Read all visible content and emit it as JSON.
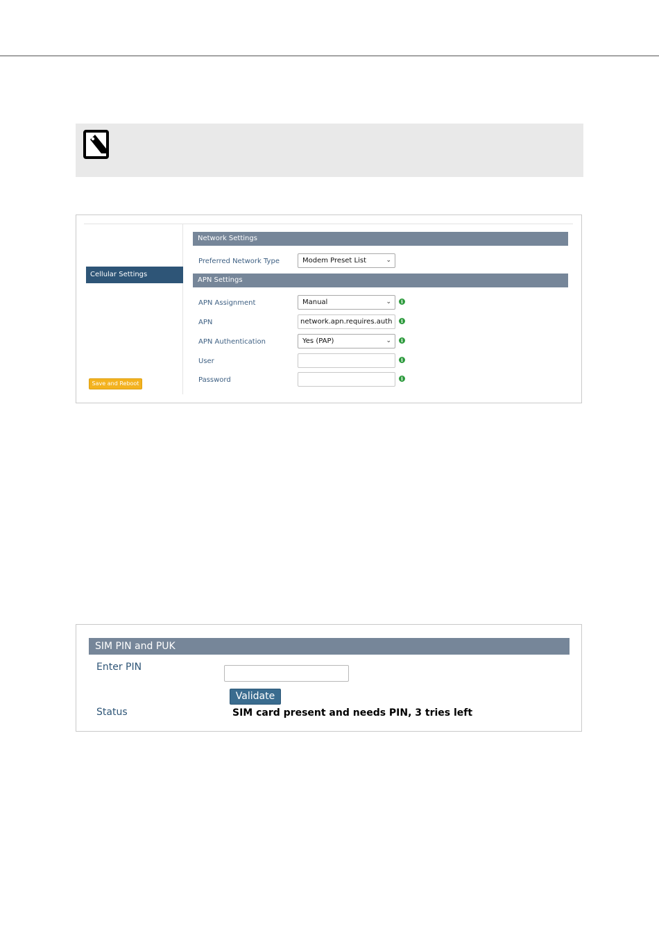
{
  "note": {
    "icon": "note-pencil-icon"
  },
  "panel1": {
    "sidebar": {
      "cellular_settings": "Cellular Settings",
      "save_reboot": "Save and Reboot"
    },
    "network_settings": {
      "header": "Network Settings",
      "preferred_network_type": {
        "label": "Preferred Network Type",
        "value": "Modem Preset List"
      }
    },
    "apn_settings": {
      "header": "APN Settings",
      "apn_assignment": {
        "label": "APN Assignment",
        "value": "Manual"
      },
      "apn": {
        "label": "APN",
        "value": "network.apn.requires.auth"
      },
      "apn_authentication": {
        "label": "APN Authentication",
        "value": "Yes (PAP)"
      },
      "user": {
        "label": "User",
        "value": ""
      },
      "password": {
        "label": "Password",
        "value": ""
      }
    }
  },
  "panel2": {
    "header": "SIM PIN and PUK",
    "enter_pin": {
      "label": "Enter PIN",
      "value": ""
    },
    "validate_label": "Validate",
    "status": {
      "label": "Status",
      "value": "SIM card present and needs PIN, 3 tries left"
    }
  },
  "colors": {
    "sidebar_active": "#2e5577",
    "section_header": "#768699",
    "save_button": "#f3b21f",
    "info_icon": "#2e9b3e",
    "validate_button": "#3a6c8f",
    "label_text": "#3d5f82"
  }
}
